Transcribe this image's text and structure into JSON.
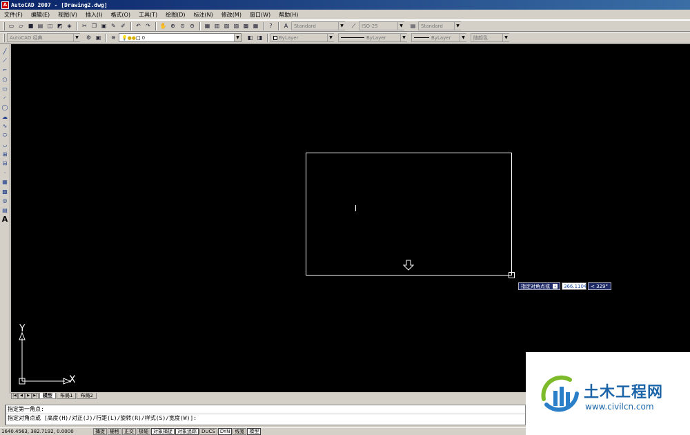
{
  "window": {
    "title": "AutoCAD 2007 - [Drawing2.dwg]"
  },
  "menu": [
    "文件(F)",
    "编辑(E)",
    "视图(V)",
    "插入(I)",
    "格式(O)",
    "工具(T)",
    "绘图(D)",
    "标注(N)",
    "修改(M)",
    "窗口(W)",
    "帮助(H)"
  ],
  "styles": {
    "text_style": "Standard",
    "dim_style": "ISO-25",
    "table_style": "Standard"
  },
  "workspace": {
    "name": "AutoCAD 经典"
  },
  "layer": {
    "current": "0"
  },
  "properties": {
    "color": "ByLayer",
    "linetype": "ByLayer",
    "lineweight": "ByLayer",
    "plot_style": "随颜色"
  },
  "dynamic_input": {
    "prompt": "指定对角点或",
    "value": "366.1104",
    "angle": "< 329°"
  },
  "ucs": {
    "x": "X",
    "y": "Y"
  },
  "tabs": [
    "模型",
    "布局1",
    "布局2"
  ],
  "command": {
    "line1": "指定第一角点:",
    "line2": "指定对角点或 [高度(H)/对正(J)/行距(L)/旋转(R)/样式(S)/宽度(W)]:"
  },
  "status": {
    "coords": "1640.4563, 382.7192, 0.0000",
    "buttons": [
      "捕捉",
      "栅格",
      "正交",
      "极轴",
      "对象捕捉",
      "对象追踪",
      "DUCS",
      "DYN",
      "线宽",
      "模型"
    ]
  },
  "watermark": {
    "title": "土木工程网",
    "url": "www.civilcn.com"
  },
  "colors": {
    "canvas": "#000000",
    "ui": "#d4d0c8",
    "title_start": "#0a246a",
    "title_end": "#3a6ea5",
    "brand": "#1b64a8"
  }
}
